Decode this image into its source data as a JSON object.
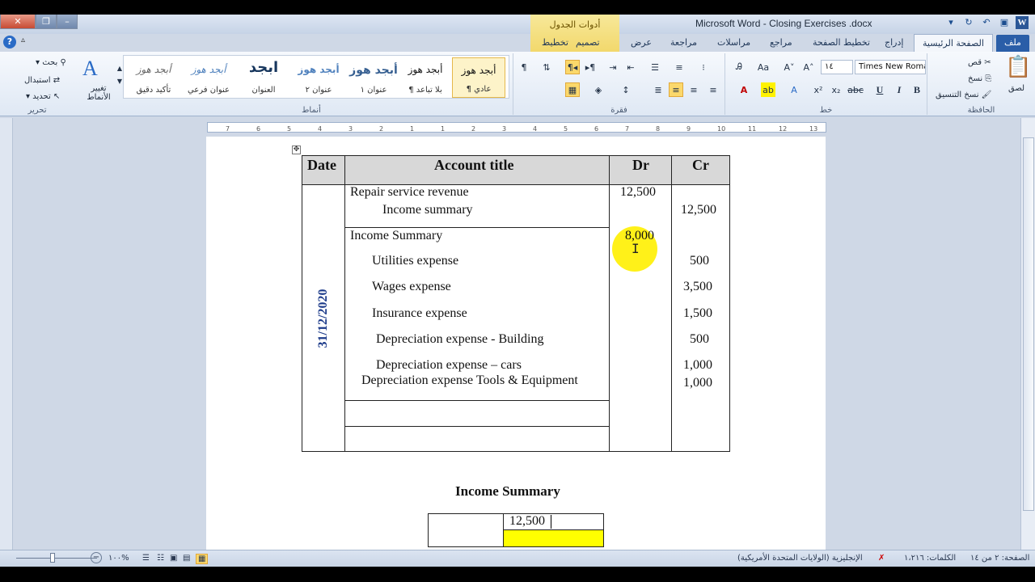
{
  "window": {
    "title": "Microsoft Word  -  Closing Exercises .docx",
    "contextual_tab_group": "أدوات الجدول"
  },
  "tabs": {
    "file": "ملف",
    "home": "الصفحة الرئيسية",
    "insert": "إدراج",
    "page_layout": "تخطيط الصفحة",
    "references": "مراجع",
    "mailings": "مراسلات",
    "review": "مراجعة",
    "view": "عرض",
    "design": "تصميم",
    "layout": "تخطيط"
  },
  "ribbon": {
    "clipboard": {
      "name": "الحافظة",
      "paste": "لصق",
      "cut": "قص",
      "copy": "نسخ",
      "format_painter": "نسخ التنسيق"
    },
    "font": {
      "name": "خط",
      "font_name": "Times New Roma",
      "font_size": "١٤"
    },
    "paragraph": {
      "name": "فقرة"
    },
    "styles": {
      "name": "أنماط",
      "items": [
        {
          "sample": "أبجد هوز",
          "label": "¶ عادي"
        },
        {
          "sample": "أبجد هوز",
          "label": "¶ بلا تباعد"
        },
        {
          "sample": "أبجد هوز",
          "label": "عنوان ١"
        },
        {
          "sample": "أبجد هوز",
          "label": "عنوان ٢"
        },
        {
          "sample": "ابجد",
          "label": "العنوان"
        },
        {
          "sample": "أبجد هوز",
          "label": "عنوان فرعي"
        },
        {
          "sample": "أبجد هوز",
          "label": "تأكيد دقيق"
        }
      ],
      "change_styles": "تغيير الأنماط"
    },
    "editing": {
      "name": "تحرير",
      "find": "بحث",
      "replace": "استبدال",
      "select": "تحديد"
    }
  },
  "ruler": {
    "ticks": [
      "7",
      "6",
      "5",
      "4",
      "3",
      "2",
      "1",
      "1",
      "2",
      "3",
      "4",
      "5",
      "6",
      "7",
      "8",
      "9",
      "10",
      "11",
      "12",
      "13"
    ]
  },
  "table": {
    "headers": {
      "date": "Date",
      "account": "Account title",
      "dr": "Dr",
      "cr": "Cr"
    },
    "date_value": "31/12/2020",
    "entry1": {
      "line1": "Repair service revenue",
      "line2": "Income summary",
      "dr": "12,500",
      "cr": "12,500"
    },
    "entry2": {
      "header": "Income Summary",
      "dr": "8,000",
      "lines": [
        {
          "account": "Utilities expense",
          "cr": "500"
        },
        {
          "account": "Wages expense",
          "cr": "3,500"
        },
        {
          "account": "Insurance expense",
          "cr": "1,500"
        },
        {
          "account": "Depreciation expense - Building",
          "cr": "500"
        },
        {
          "account": "Depreciation expense – cars",
          "cr": "1,000"
        },
        {
          "account": "Depreciation expense Tools & Equipment",
          "cr": "1,000"
        }
      ]
    }
  },
  "t_account": {
    "title": "Income  Summary",
    "credit_value": "12,500",
    "highlight_color": "#ffff00"
  },
  "statusbar": {
    "page": "الصفحة: ٢ من ١٤",
    "words": "الكلمات: ١،٢١٦",
    "language": "الإنجليزية (الولايات المتحدة الأمريكية)",
    "zoom": "١٠٠%"
  }
}
